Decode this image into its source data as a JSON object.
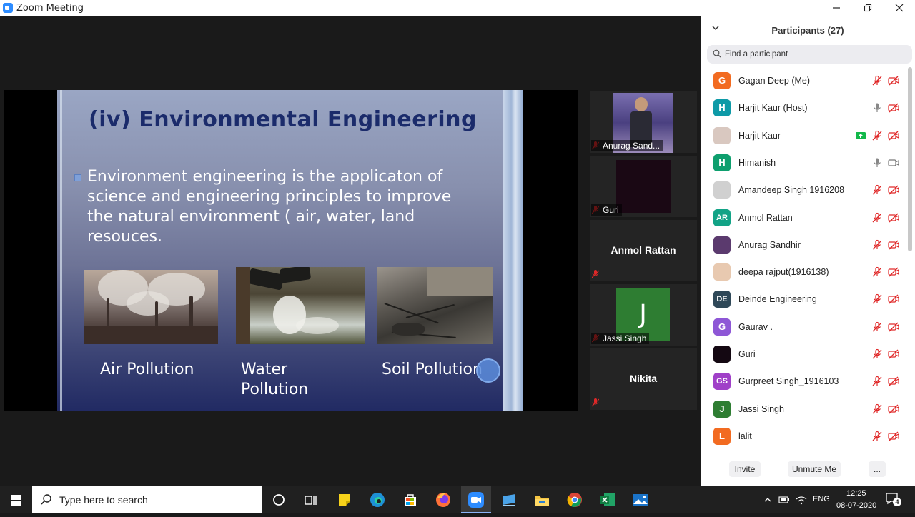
{
  "window": {
    "title": "Zoom Meeting",
    "controls": [
      "minimize",
      "restore",
      "close"
    ]
  },
  "slide": {
    "title": "(iv) Environmental Engineering",
    "body_lines": [
      "Environment engineering is the applicaton of",
      "science and engineering principles to improve",
      "the natural environment ( air, water, land",
      "resouces."
    ],
    "captions": {
      "air": "Air Pollution",
      "water_1": "Water",
      "water_2": "Pollution",
      "soil": "Soil Pollution"
    }
  },
  "gallery": [
    {
      "name": "Anurag Sand...",
      "muted": true,
      "kind": "video"
    },
    {
      "name": "Guri",
      "muted": true,
      "kind": "dark"
    },
    {
      "name": "Anmol Rattan",
      "muted": true,
      "kind": "name-only"
    },
    {
      "name": "Jassi Singh",
      "muted": true,
      "kind": "initial",
      "initial": "J",
      "color": "#2e7d32"
    },
    {
      "name": "Nikita",
      "muted": true,
      "kind": "name-only"
    }
  ],
  "participants_panel": {
    "title": "Participants (27)",
    "search_placeholder": "Find a participant",
    "participants": [
      {
        "name": "Gagan Deep (Me)",
        "initials": "G",
        "color": "#f26b21",
        "mic": "off",
        "video": "off"
      },
      {
        "name": "Harjit Kaur (Host)",
        "initials": "H",
        "color": "#0e9aa7",
        "mic": "on",
        "video": "off"
      },
      {
        "name": "Harjit Kaur",
        "initials": "",
        "color": "#d9c8c0",
        "mic": "off",
        "video": "off",
        "sharing": true
      },
      {
        "name": "Himanish",
        "initials": "H",
        "color": "#0e9f6e",
        "mic": "on",
        "video": "on"
      },
      {
        "name": "Amandeep Singh 1916208",
        "initials": "",
        "color": "#d0d0d0",
        "mic": "off",
        "video": "off"
      },
      {
        "name": "Anmol Rattan",
        "initials": "AR",
        "color": "#12a386",
        "mic": "off",
        "video": "off"
      },
      {
        "name": "Anurag Sandhir",
        "initials": "",
        "color": "#5b3a6e",
        "mic": "off",
        "video": "off"
      },
      {
        "name": "deepa rajput(1916138)",
        "initials": "",
        "color": "#e8c9b0",
        "mic": "off",
        "video": "off"
      },
      {
        "name": "Deinde Engineering",
        "initials": "DE",
        "color": "#2f4858",
        "mic": "off",
        "video": "off"
      },
      {
        "name": "Gaurav .",
        "initials": "G",
        "color": "#8e57d6",
        "mic": "off",
        "video": "off"
      },
      {
        "name": "Guri",
        "initials": "",
        "color": "#140812",
        "mic": "off",
        "video": "off"
      },
      {
        "name": "Gurpreet Singh_1916103",
        "initials": "GS",
        "color": "#a040c8",
        "mic": "off",
        "video": "off"
      },
      {
        "name": "Jassi Singh",
        "initials": "J",
        "color": "#2e7d32",
        "mic": "off",
        "video": "off"
      },
      {
        "name": "lalit",
        "initials": "L",
        "color": "#f26b21",
        "mic": "off",
        "video": "off"
      }
    ],
    "footer": {
      "invite": "Invite",
      "unmute": "Unmute Me",
      "more": "..."
    }
  },
  "taskbar": {
    "search_placeholder": "Type here to search",
    "apps": [
      "task-view",
      "sticky-notes",
      "edge",
      "store",
      "firefox",
      "zoom",
      "file-explorer-remote",
      "file-explorer",
      "chrome",
      "excel",
      "photos"
    ],
    "tray": {
      "language": "ENG",
      "time": "12:25",
      "date": "08-07-2020",
      "notifications": "4"
    }
  }
}
